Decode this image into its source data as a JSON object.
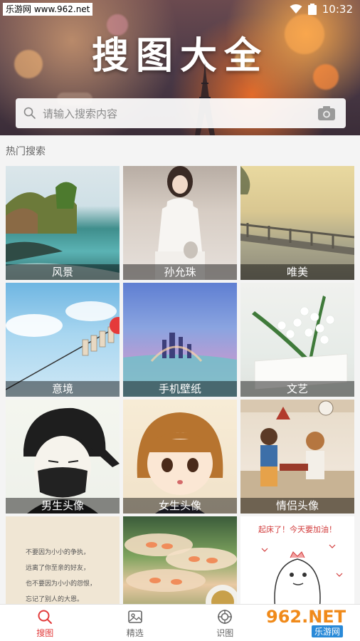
{
  "status": {
    "source_label": "乐游网 www.962.net",
    "time": "10:32"
  },
  "header": {
    "title": "搜图大全"
  },
  "search": {
    "placeholder": "请输入搜索内容"
  },
  "hot": {
    "label": "热门搜索",
    "tiles": [
      {
        "label": "风景"
      },
      {
        "label": "孙允珠"
      },
      {
        "label": "唯美"
      },
      {
        "label": "意境"
      },
      {
        "label": "手机壁纸"
      },
      {
        "label": "文艺"
      },
      {
        "label": "男生头像"
      },
      {
        "label": "女生头像"
      },
      {
        "label": "情侣头像"
      },
      {
        "label": ""
      },
      {
        "label": ""
      },
      {
        "label": ""
      }
    ],
    "quote_lines": [
      "不要因为小小的争执，",
      "远离了你至亲的好友，",
      "也不要因为小小的怨恨，",
      "忘记了别人的大恩。"
    ],
    "cute_text": "起床了！今天要加油！"
  },
  "tabbar": {
    "items": [
      {
        "label": "搜图",
        "icon": "search-icon",
        "active": true
      },
      {
        "label": "精选",
        "icon": "image-icon",
        "active": false
      },
      {
        "label": "识图",
        "icon": "target-icon",
        "active": false
      },
      {
        "label": "",
        "icon": "user-icon",
        "active": false
      }
    ]
  },
  "watermark": {
    "brand": "962.NET",
    "sub": "乐游网"
  },
  "colors": {
    "accent": "#e23b3b"
  }
}
